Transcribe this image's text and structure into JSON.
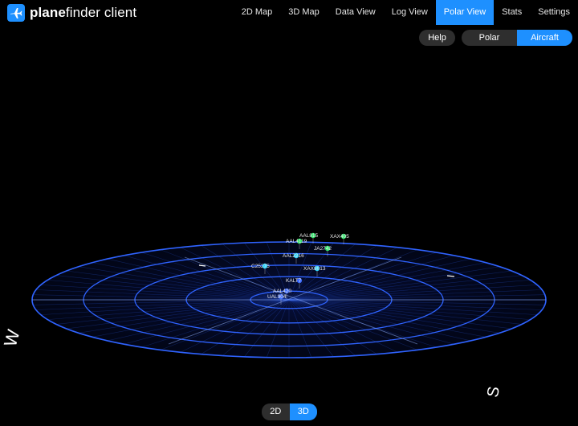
{
  "app": {
    "brand_bold": "plane",
    "brand_rest": "finder client"
  },
  "nav": {
    "items": [
      {
        "label": "2D Map",
        "active": false
      },
      {
        "label": "3D Map",
        "active": false
      },
      {
        "label": "Data View",
        "active": false
      },
      {
        "label": "Log View",
        "active": false
      },
      {
        "label": "Polar View",
        "active": true
      },
      {
        "label": "Stats",
        "active": false
      },
      {
        "label": "Settings",
        "active": false
      }
    ]
  },
  "controls": {
    "help_label": "Help",
    "view_mode": [
      {
        "label": "Polar",
        "active": false
      },
      {
        "label": "Aircraft",
        "active": true
      }
    ],
    "dimension": [
      {
        "label": "2D",
        "active": false
      },
      {
        "label": "3D",
        "active": true
      }
    ]
  },
  "colors": {
    "accent": "#1e90ff",
    "grid": "#2f63ff",
    "aircraft_green": "#2ee86b",
    "aircraft_cyan": "#2fd6ff",
    "aircraft_blue": "#3d6bff"
  },
  "polar": {
    "compass_labels": {
      "west": "W",
      "south": "S"
    },
    "aircraft": [
      {
        "label": "AAL815"
      },
      {
        "label": "XAX405"
      },
      {
        "label": "AAL4119"
      },
      {
        "label": "JA2742"
      },
      {
        "label": "AAL2216"
      },
      {
        "label": "C25275"
      },
      {
        "label": "XAX8013"
      },
      {
        "label": "KALT7"
      },
      {
        "label": "AAL420"
      },
      {
        "label": "UAL904"
      }
    ]
  }
}
